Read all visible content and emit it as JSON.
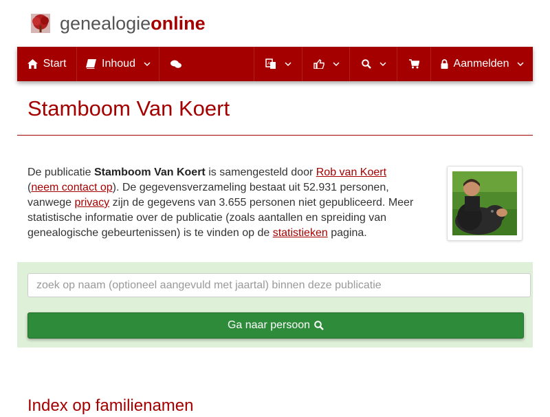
{
  "header": {
    "logo_main": "genealogie",
    "logo_accent": "online",
    "brand_color": "#a50000"
  },
  "nav": {
    "start_label": "Start",
    "inhoud_label": "Inhoud",
    "login_label": "Aanmelden",
    "icons": [
      "home-icon",
      "book-icon",
      "chat-icon",
      "translate-icon",
      "thumbs-up-icon",
      "search-icon",
      "cart-icon",
      "lock-icon"
    ]
  },
  "page": {
    "title": "Stamboom Van Koert"
  },
  "intro": {
    "t1": "De publicatie ",
    "publication": "Stamboom Van Koert",
    "t2": " is samengesteld door ",
    "author": "Rob van Koert",
    "t3": "(",
    "contact": "neem contact op",
    "t4": "). De gegevensverzameling bestaat uit 52.931 personen, vanwege ",
    "privacy": "privacy",
    "t5": " zijn de gegevens van 3.655 personen niet gepubliceerd. Meer statistische informatie over de publicatie (zoals aantallen en spreiding van genealogische gebeurtenissen) is te vinden op de ",
    "stats": "statistieken",
    "t6": " pagina."
  },
  "search": {
    "placeholder": "zoek op naam (optioneel aangevuld met jaartal) binnen deze publicatie",
    "value": "",
    "button_label": "Ga naar persoon",
    "panel_color": "#dff0d8",
    "button_color": "#2e8b3a"
  },
  "index": {
    "title": "Index op familienamen"
  }
}
